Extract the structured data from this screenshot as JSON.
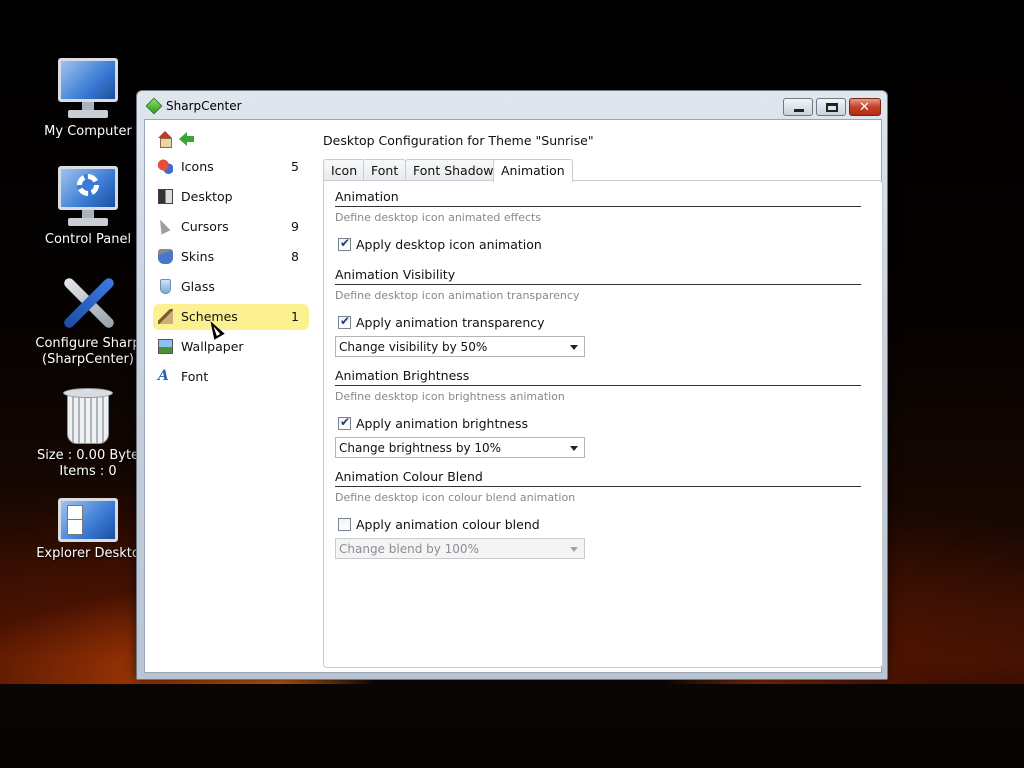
{
  "desktop": {
    "icons": [
      {
        "label": "My Computer"
      },
      {
        "label": "Control Panel"
      },
      {
        "label": "Configure Sharp",
        "label2": "(SharpCenter)"
      },
      {
        "label": "Size : 0.00 Byte",
        "label2": "Items : 0"
      },
      {
        "label": "Explorer Deskto"
      }
    ]
  },
  "window": {
    "title": "SharpCenter",
    "buttons": {
      "minimize": "–",
      "maximize": "□",
      "close": "✕"
    }
  },
  "sidebar": {
    "items": [
      {
        "label": "Icons",
        "count": "5",
        "icon": "icons-icon"
      },
      {
        "label": "Desktop",
        "count": "",
        "icon": "desktop-icon"
      },
      {
        "label": "Cursors",
        "count": "9",
        "icon": "cursor-icon"
      },
      {
        "label": "Skins",
        "count": "8",
        "icon": "skins-icon"
      },
      {
        "label": "Glass",
        "count": "",
        "icon": "glass-icon"
      },
      {
        "label": "Schemes",
        "count": "1",
        "icon": "brush-icon",
        "selected": true
      },
      {
        "label": "Wallpaper",
        "count": "",
        "icon": "wallpaper-icon"
      },
      {
        "label": "Font",
        "count": "",
        "icon": "font-icon",
        "glyph": "A"
      }
    ]
  },
  "main": {
    "title": "Desktop Configuration for Theme \"Sunrise\"",
    "tabs": [
      {
        "label": "Icon"
      },
      {
        "label": "Font"
      },
      {
        "label": "Font Shadow"
      },
      {
        "label": "Animation",
        "active": true
      }
    ],
    "sections": [
      {
        "heading": "Animation",
        "description": "Define desktop icon animated effects",
        "checkbox": {
          "label": "Apply desktop icon animation",
          "checked": true
        }
      },
      {
        "heading": "Animation Visibility",
        "description": "Define desktop icon animation transparency",
        "checkbox": {
          "label": "Apply animation transparency",
          "checked": true
        },
        "select": {
          "value": "Change visibility by 50%",
          "enabled": true
        }
      },
      {
        "heading": "Animation Brightness",
        "description": "Define desktop icon brightness animation",
        "checkbox": {
          "label": "Apply animation brightness",
          "checked": true
        },
        "select": {
          "value": "Change brightness by 10%",
          "enabled": true
        }
      },
      {
        "heading": "Animation Colour Blend",
        "description": "Define desktop icon colour blend animation",
        "checkbox": {
          "label": "Apply animation colour blend",
          "checked": false
        },
        "select": {
          "value": "Change blend by 100%",
          "enabled": false
        }
      }
    ],
    "check_glyph": "✔"
  },
  "colors": {
    "selected_item": "#fbf191",
    "close_button": "#c4402a",
    "description_text": "#888888"
  }
}
